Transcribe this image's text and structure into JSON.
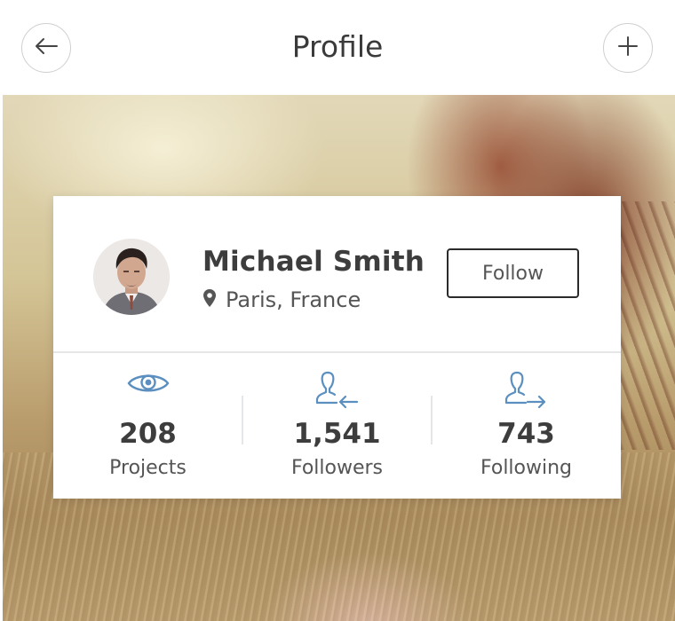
{
  "header": {
    "title": "Profile",
    "back_icon": "arrow-left-icon",
    "add_icon": "plus-icon"
  },
  "profile": {
    "name": "Michael Smith",
    "location": "Paris, France",
    "location_icon": "map-pin-icon",
    "follow_label": "Follow"
  },
  "stats": [
    {
      "icon": "eye-icon",
      "value": "208",
      "label": "Projects"
    },
    {
      "icon": "user-incoming-icon",
      "value": "1,541",
      "label": "Followers"
    },
    {
      "icon": "user-outgoing-icon",
      "value": "743",
      "label": "Following"
    }
  ],
  "colors": {
    "accent_icon": "#5b8fc0",
    "text_dark": "#3d3d3d",
    "text_muted": "#555555",
    "divider": "#e4e6e8"
  }
}
